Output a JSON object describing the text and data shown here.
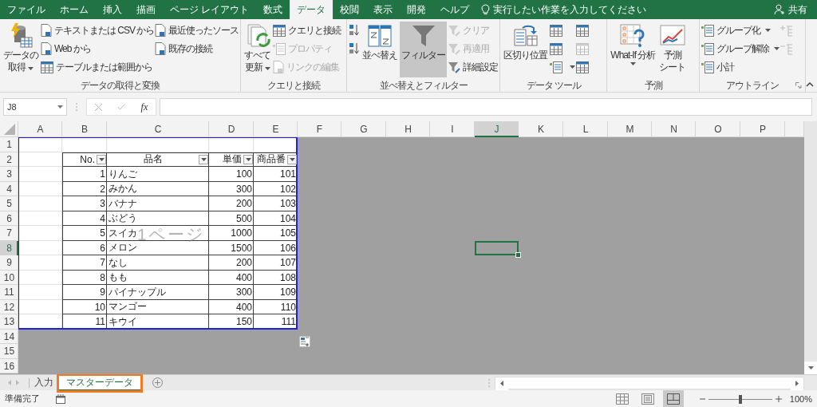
{
  "ribbon_tabs": [
    {
      "label": "ファイル",
      "selected": false
    },
    {
      "label": "ホーム",
      "selected": false
    },
    {
      "label": "挿入",
      "selected": false
    },
    {
      "label": "描画",
      "selected": false
    },
    {
      "label": "ページ レイアウト",
      "selected": false
    },
    {
      "label": "数式",
      "selected": false
    },
    {
      "label": "データ",
      "selected": true
    },
    {
      "label": "校閲",
      "selected": false
    },
    {
      "label": "表示",
      "selected": false
    },
    {
      "label": "開発",
      "selected": false
    },
    {
      "label": "ヘルプ",
      "selected": false
    }
  ],
  "tell_me": {
    "placeholder": "実行したい作業を入力してください"
  },
  "share": {
    "label": "共有"
  },
  "ribbon_groups": [
    {
      "label": "データの取得と変換",
      "columns": [
        {
          "kind": "large",
          "lines": [
            "データの",
            "取得"
          ],
          "dropdown": true,
          "disabled": false,
          "selected": false
        },
        {
          "kind": "stack",
          "items": [
            {
              "label": "テキストまたは CSV から",
              "disabled": false,
              "dropdown": false
            },
            {
              "label": "Web から",
              "disabled": false,
              "dropdown": false
            },
            {
              "label": "テーブルまたは範囲から",
              "disabled": false,
              "dropdown": false
            }
          ]
        },
        {
          "kind": "stack",
          "items": [
            {
              "label": "最近使ったソース",
              "disabled": false,
              "dropdown": false
            },
            {
              "label": "既存の接続",
              "disabled": false,
              "dropdown": false
            }
          ]
        }
      ]
    },
    {
      "label": "クエリと接続",
      "columns": [
        {
          "kind": "large",
          "lines": [
            "すべて",
            "更新"
          ],
          "dropdown": true,
          "disabled": false,
          "selected": false
        },
        {
          "kind": "stack",
          "items": [
            {
              "label": "クエリと接続",
              "disabled": false,
              "dropdown": false
            },
            {
              "label": "プロパティ",
              "disabled": true,
              "dropdown": false
            },
            {
              "label": "リンクの編集",
              "disabled": true,
              "dropdown": false
            }
          ]
        }
      ]
    },
    {
      "label": "並べ替えとフィルター",
      "columns": [
        {
          "kind": "stack",
          "items": [
            {
              "disabled": false,
              "dropdown": false
            },
            {
              "disabled": false,
              "dropdown": false
            }
          ]
        },
        {
          "kind": "large",
          "lines": [
            "並べ替え"
          ],
          "dropdown": false,
          "disabled": false,
          "selected": false
        },
        {
          "kind": "large",
          "lines": [
            "フィルター"
          ],
          "dropdown": false,
          "disabled": false,
          "selected": true
        },
        {
          "kind": "stack",
          "items": [
            {
              "label": "クリア",
              "disabled": true,
              "dropdown": false
            },
            {
              "label": "再適用",
              "disabled": true,
              "dropdown": false
            },
            {
              "label": "詳細設定",
              "disabled": false,
              "dropdown": false
            }
          ]
        }
      ]
    },
    {
      "label": "データ ツール",
      "columns": [
        {
          "kind": "large",
          "lines": [
            "区切り位置"
          ],
          "dropdown": false,
          "disabled": false,
          "selected": false
        },
        {
          "kind": "stack",
          "items": [
            {
              "disabled": false,
              "dropdown": false
            },
            {
              "disabled": false,
              "dropdown": false
            },
            {
              "disabled": false,
              "dropdown": true
            }
          ]
        },
        {
          "kind": "stack",
          "items": [
            {
              "disabled": false,
              "dropdown": false
            },
            {
              "disabled": true,
              "dropdown": false
            },
            {
              "disabled": false,
              "dropdown": false
            }
          ]
        }
      ]
    },
    {
      "label": "予測",
      "columns": [
        {
          "kind": "large",
          "lines": [
            "What-If 分析"
          ],
          "dropdown": true,
          "disabled": false,
          "selected": false
        },
        {
          "kind": "large",
          "lines": [
            "予測",
            "シート"
          ],
          "dropdown": false,
          "disabled": false,
          "selected": false
        }
      ]
    },
    {
      "label": "アウトライン",
      "columns": [
        {
          "kind": "stack",
          "items": [
            {
              "label": "グループ化",
              "disabled": false,
              "dropdown": true
            },
            {
              "label": "グループ解除",
              "disabled": false,
              "dropdown": true
            },
            {
              "label": "小計",
              "disabled": false,
              "dropdown": false
            }
          ]
        },
        {
          "kind": "stack",
          "items": [
            {
              "disabled": true,
              "dropdown": false
            },
            {
              "disabled": true,
              "dropdown": false
            }
          ]
        }
      ]
    }
  ],
  "formula_bar": {
    "name_box": "J8",
    "fx": "fx"
  },
  "columns": [
    {
      "label": "A",
      "selected": false
    },
    {
      "label": "B",
      "selected": false
    },
    {
      "label": "C",
      "selected": false
    },
    {
      "label": "D",
      "selected": false
    },
    {
      "label": "E",
      "selected": false
    },
    {
      "label": "F",
      "selected": false
    },
    {
      "label": "G",
      "selected": false
    },
    {
      "label": "H",
      "selected": false
    },
    {
      "label": "I",
      "selected": false
    },
    {
      "label": "J",
      "selected": true
    },
    {
      "label": "K",
      "selected": false
    },
    {
      "label": "L",
      "selected": false
    },
    {
      "label": "M",
      "selected": false
    },
    {
      "label": "N",
      "selected": false
    },
    {
      "label": "O",
      "selected": false
    },
    {
      "label": "P",
      "selected": false
    }
  ],
  "rows": [
    {
      "label": "1",
      "selected": false,
      "cells": [
        {
          "kind": "blank"
        },
        {
          "kind": "blank"
        },
        {
          "kind": "blank"
        },
        {
          "kind": "blank"
        },
        {
          "kind": "blank"
        }
      ]
    },
    {
      "label": "2",
      "selected": false,
      "cells": [
        {
          "kind": "blank"
        },
        {
          "kind": "header",
          "text": "No."
        },
        {
          "kind": "header",
          "text": "品名"
        },
        {
          "kind": "header",
          "text": "単価"
        },
        {
          "kind": "header",
          "text": "商品番"
        }
      ]
    },
    {
      "label": "3",
      "selected": false,
      "cells": [
        {
          "kind": "blank"
        },
        {
          "kind": "number",
          "text": "1"
        },
        {
          "kind": "text",
          "text": "りんご"
        },
        {
          "kind": "number",
          "text": "100"
        },
        {
          "kind": "number",
          "text": "101"
        }
      ]
    },
    {
      "label": "4",
      "selected": false,
      "cells": [
        {
          "kind": "blank"
        },
        {
          "kind": "number",
          "text": "2"
        },
        {
          "kind": "text",
          "text": "みかん"
        },
        {
          "kind": "number",
          "text": "300"
        },
        {
          "kind": "number",
          "text": "102"
        }
      ]
    },
    {
      "label": "5",
      "selected": false,
      "cells": [
        {
          "kind": "blank"
        },
        {
          "kind": "number",
          "text": "3"
        },
        {
          "kind": "text",
          "text": "バナナ"
        },
        {
          "kind": "number",
          "text": "200"
        },
        {
          "kind": "number",
          "text": "103"
        }
      ]
    },
    {
      "label": "6",
      "selected": false,
      "cells": [
        {
          "kind": "blank"
        },
        {
          "kind": "number",
          "text": "4"
        },
        {
          "kind": "text",
          "text": "ぶどう"
        },
        {
          "kind": "number",
          "text": "500"
        },
        {
          "kind": "number",
          "text": "104"
        }
      ]
    },
    {
      "label": "7",
      "selected": false,
      "cells": [
        {
          "kind": "blank"
        },
        {
          "kind": "number",
          "text": "5"
        },
        {
          "kind": "text",
          "text": "スイカ"
        },
        {
          "kind": "number",
          "text": "1000"
        },
        {
          "kind": "number",
          "text": "105"
        }
      ]
    },
    {
      "label": "8",
      "selected": true,
      "cells": [
        {
          "kind": "blank"
        },
        {
          "kind": "number",
          "text": "6"
        },
        {
          "kind": "text",
          "text": "メロン"
        },
        {
          "kind": "number",
          "text": "1500"
        },
        {
          "kind": "number",
          "text": "106"
        }
      ]
    },
    {
      "label": "9",
      "selected": false,
      "cells": [
        {
          "kind": "blank"
        },
        {
          "kind": "number",
          "text": "7"
        },
        {
          "kind": "text",
          "text": "なし"
        },
        {
          "kind": "number",
          "text": "200"
        },
        {
          "kind": "number",
          "text": "107"
        }
      ]
    },
    {
      "label": "10",
      "selected": false,
      "cells": [
        {
          "kind": "blank"
        },
        {
          "kind": "number",
          "text": "8"
        },
        {
          "kind": "text",
          "text": "もも"
        },
        {
          "kind": "number",
          "text": "400"
        },
        {
          "kind": "number",
          "text": "108"
        }
      ]
    },
    {
      "label": "11",
      "selected": false,
      "cells": [
        {
          "kind": "blank"
        },
        {
          "kind": "number",
          "text": "9"
        },
        {
          "kind": "text",
          "text": "パイナップル"
        },
        {
          "kind": "number",
          "text": "300"
        },
        {
          "kind": "number",
          "text": "109"
        }
      ]
    },
    {
      "label": "12",
      "selected": false,
      "cells": [
        {
          "kind": "blank"
        },
        {
          "kind": "number",
          "text": "10"
        },
        {
          "kind": "text",
          "text": "マンゴー"
        },
        {
          "kind": "number",
          "text": "400"
        },
        {
          "kind": "number",
          "text": "110"
        }
      ]
    },
    {
      "label": "13",
      "selected": false,
      "cells": [
        {
          "kind": "blank"
        },
        {
          "kind": "number",
          "text": "11"
        },
        {
          "kind": "text",
          "text": "キウイ"
        },
        {
          "kind": "number",
          "text": "150"
        },
        {
          "kind": "number",
          "text": "111"
        }
      ]
    },
    {
      "label": "14",
      "selected": false
    },
    {
      "label": "15",
      "selected": false
    },
    {
      "label": "16",
      "selected": false
    }
  ],
  "page_label": "1ページ",
  "sheet_tabs": [
    {
      "label": "入力",
      "selected": false,
      "highlighted": false
    },
    {
      "label": "マスターデータ",
      "selected": true,
      "highlighted": true
    }
  ],
  "status": "準備完了",
  "view_buttons": [
    {
      "selected": false
    },
    {
      "selected": false
    },
    {
      "selected": true
    }
  ],
  "zoom": {
    "level": 0.5,
    "label": "100%"
  }
}
